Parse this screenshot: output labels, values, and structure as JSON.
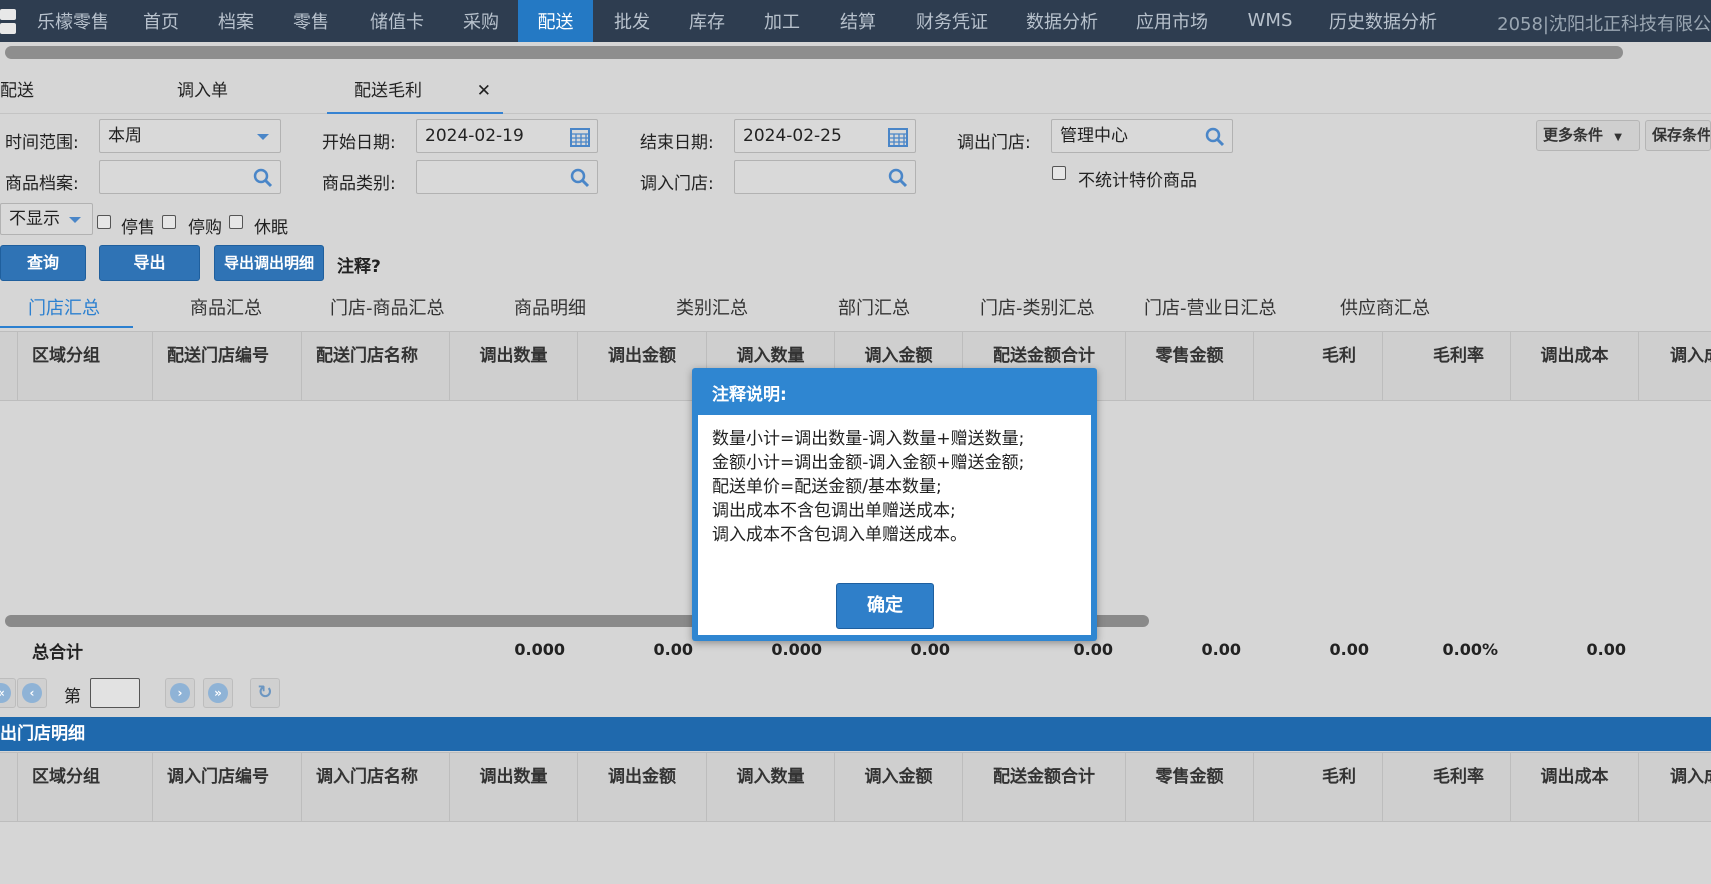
{
  "topnav": {
    "items": [
      "乐檬零售",
      "首页",
      "档案",
      "零售",
      "储值卡",
      "采购",
      "配送",
      "批发",
      "库存",
      "加工",
      "结算",
      "财务凭证",
      "数据分析",
      "应用市场",
      "WMS",
      "历史数据分析"
    ],
    "active": "配送",
    "company": "2058|沈阳北正科技有限公"
  },
  "page_tabs": [
    "配送",
    "调入单",
    "配送毛利"
  ],
  "filters": {
    "time_range_label": "时间范围:",
    "time_range_value": "本周",
    "start_date_label": "开始日期:",
    "start_date_value": "2024-02-19",
    "end_date_label": "结束日期:",
    "end_date_value": "2024-02-25",
    "out_store_label": "调出门店:",
    "out_store_value": "管理中心",
    "product_label": "商品档案:",
    "category_label": "商品类别:",
    "in_store_label": "调入门店:",
    "no_special_label": "不统计特价商品",
    "display_value": "不显示",
    "stop_sale_label": "停售",
    "stop_purchase_label": "停购",
    "dormant_label": "休眠",
    "more_conditions": "更多条件",
    "save_conditions": "保存条件"
  },
  "actions": {
    "query": "查询",
    "export": "导出",
    "export_detail": "导出调出明细",
    "note_link": "注释?"
  },
  "subtabs": [
    "门店汇总",
    "商品汇总",
    "门店-商品汇总",
    "商品明细",
    "类别汇总",
    "部门汇总",
    "门店-类别汇总",
    "门店-营业日汇总",
    "供应商汇总"
  ],
  "grid1": {
    "columns": [
      "区域分组",
      "配送门店编号",
      "配送门店名称",
      "调出数量",
      "调出金额",
      "调入数量",
      "调入金额",
      "配送金额合计",
      "零售金额",
      "毛利",
      "毛利率",
      "调出成本",
      "调入成"
    ]
  },
  "totals": {
    "label": "总合计",
    "values": [
      "0.000",
      "0.00",
      "0.000",
      "0.00",
      "0.00",
      "0.00",
      "0.00",
      "0.00%",
      "0.00"
    ]
  },
  "pager": {
    "page_label": "第"
  },
  "detail_section": {
    "title": "出门店明细",
    "columns": [
      "区域分组",
      "调入门店编号",
      "调入门店名称",
      "调出数量",
      "调出金额",
      "调入数量",
      "调入金额",
      "配送金额合计",
      "零售金额",
      "毛利",
      "毛利率",
      "调出成本",
      "调入成"
    ]
  },
  "dialog": {
    "title": "注释说明:",
    "lines": [
      "数量小计=调出数量-调入数量+赠送数量;",
      "金额小计=调出金额-调入金额+赠送金额;",
      "配送单价=配送金额/基本数量;",
      "调出成本不含包调出单赠送成本;",
      "调入成本不含包调入单赠送成本。"
    ],
    "ok": "确定"
  },
  "colors": {
    "nav_bg": "#2e3d50",
    "nav_active": "#2479c4",
    "accent": "#2c80d0",
    "dialog_header": "#2f86d1"
  }
}
